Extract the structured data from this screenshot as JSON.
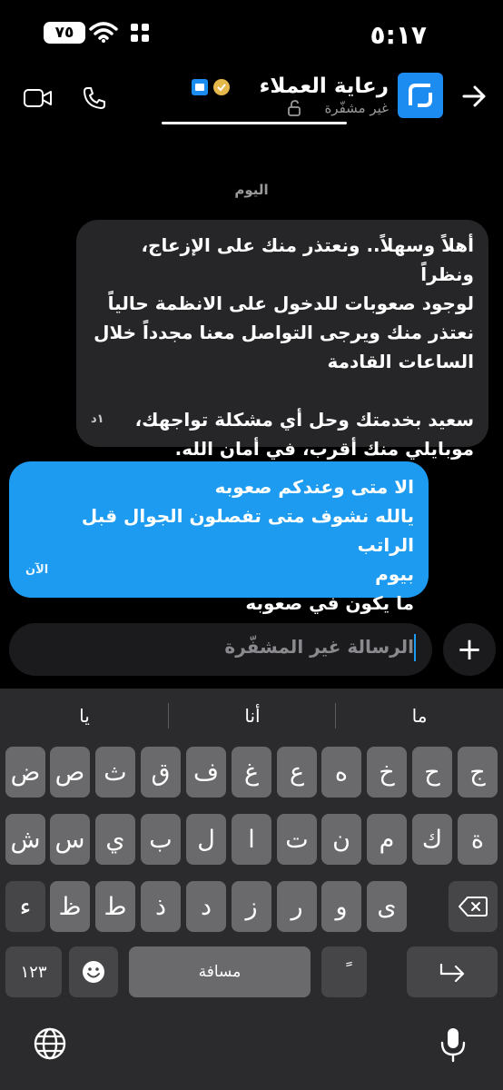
{
  "status_bar": {
    "time": "٥:١٧",
    "battery": "٧٥"
  },
  "header": {
    "contact_name": "رعاية العملاء",
    "subtitle": "غير مشفّرة"
  },
  "chat": {
    "date_label": "اليوم",
    "messages": [
      {
        "direction": "incoming",
        "lines": [
          "أهلاً وسهلاً.. ونعتذر منك على الإزعاج، ونظراً",
          "لوجود صعوبات للدخول على الانظمة حالياً",
          "نعتذر منك ويرجى التواصل معنا مجدداً خلال",
          "الساعات القادمة",
          "",
          "سعيد بخدمتك وحل أي مشكلة تواجهك،",
          "موبايلي منك أقرب، في أمان الله."
        ],
        "time": "١د"
      },
      {
        "direction": "outgoing",
        "lines": [
          "الا متى وعندكم صعوبه",
          "يالله نشوف متى تفصلون الجوال قبل الراتب",
          "بيوم",
          "ما يكون في صعوبه"
        ],
        "time": "الآن"
      }
    ]
  },
  "composer": {
    "placeholder": "الرسالة غير المشفّرة",
    "plus": "+"
  },
  "keyboard": {
    "suggestions": [
      "ما",
      "أنا",
      "يا"
    ],
    "row1": [
      "ج",
      "ح",
      "خ",
      "ه",
      "ع",
      "غ",
      "ف",
      "ق",
      "ث",
      "ص",
      "ض"
    ],
    "row2": [
      "ة",
      "ك",
      "م",
      "ن",
      "ت",
      "ا",
      "ل",
      "ب",
      "ي",
      "س",
      "ش"
    ],
    "row3": [
      "ى",
      "و",
      "ر",
      "ز",
      "د",
      "ذ",
      "ط",
      "ظ",
      "ء"
    ],
    "numbers_label": "١٢٣",
    "space_label": "مسافة",
    "tanween_label": "ً"
  },
  "colors": {
    "accent": "#1d9bf0",
    "incoming_bubble": "#262628",
    "key": "#6a6a6c"
  }
}
